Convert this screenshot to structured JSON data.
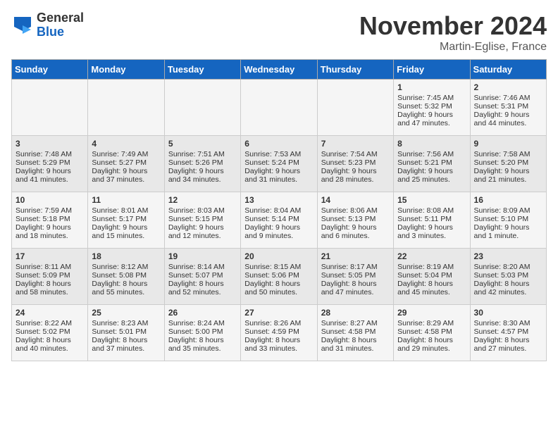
{
  "header": {
    "logo_general": "General",
    "logo_blue": "Blue",
    "month_title": "November 2024",
    "location": "Martin-Eglise, France"
  },
  "days_of_week": [
    "Sunday",
    "Monday",
    "Tuesday",
    "Wednesday",
    "Thursday",
    "Friday",
    "Saturday"
  ],
  "weeks": [
    [
      {
        "day": "",
        "content": ""
      },
      {
        "day": "",
        "content": ""
      },
      {
        "day": "",
        "content": ""
      },
      {
        "day": "",
        "content": ""
      },
      {
        "day": "",
        "content": ""
      },
      {
        "day": "1",
        "content": "Sunrise: 7:45 AM\nSunset: 5:32 PM\nDaylight: 9 hours and 47 minutes."
      },
      {
        "day": "2",
        "content": "Sunrise: 7:46 AM\nSunset: 5:31 PM\nDaylight: 9 hours and 44 minutes."
      }
    ],
    [
      {
        "day": "3",
        "content": "Sunrise: 7:48 AM\nSunset: 5:29 PM\nDaylight: 9 hours and 41 minutes."
      },
      {
        "day": "4",
        "content": "Sunrise: 7:49 AM\nSunset: 5:27 PM\nDaylight: 9 hours and 37 minutes."
      },
      {
        "day": "5",
        "content": "Sunrise: 7:51 AM\nSunset: 5:26 PM\nDaylight: 9 hours and 34 minutes."
      },
      {
        "day": "6",
        "content": "Sunrise: 7:53 AM\nSunset: 5:24 PM\nDaylight: 9 hours and 31 minutes."
      },
      {
        "day": "7",
        "content": "Sunrise: 7:54 AM\nSunset: 5:23 PM\nDaylight: 9 hours and 28 minutes."
      },
      {
        "day": "8",
        "content": "Sunrise: 7:56 AM\nSunset: 5:21 PM\nDaylight: 9 hours and 25 minutes."
      },
      {
        "day": "9",
        "content": "Sunrise: 7:58 AM\nSunset: 5:20 PM\nDaylight: 9 hours and 21 minutes."
      }
    ],
    [
      {
        "day": "10",
        "content": "Sunrise: 7:59 AM\nSunset: 5:18 PM\nDaylight: 9 hours and 18 minutes."
      },
      {
        "day": "11",
        "content": "Sunrise: 8:01 AM\nSunset: 5:17 PM\nDaylight: 9 hours and 15 minutes."
      },
      {
        "day": "12",
        "content": "Sunrise: 8:03 AM\nSunset: 5:15 PM\nDaylight: 9 hours and 12 minutes."
      },
      {
        "day": "13",
        "content": "Sunrise: 8:04 AM\nSunset: 5:14 PM\nDaylight: 9 hours and 9 minutes."
      },
      {
        "day": "14",
        "content": "Sunrise: 8:06 AM\nSunset: 5:13 PM\nDaylight: 9 hours and 6 minutes."
      },
      {
        "day": "15",
        "content": "Sunrise: 8:08 AM\nSunset: 5:11 PM\nDaylight: 9 hours and 3 minutes."
      },
      {
        "day": "16",
        "content": "Sunrise: 8:09 AM\nSunset: 5:10 PM\nDaylight: 9 hours and 1 minute."
      }
    ],
    [
      {
        "day": "17",
        "content": "Sunrise: 8:11 AM\nSunset: 5:09 PM\nDaylight: 8 hours and 58 minutes."
      },
      {
        "day": "18",
        "content": "Sunrise: 8:12 AM\nSunset: 5:08 PM\nDaylight: 8 hours and 55 minutes."
      },
      {
        "day": "19",
        "content": "Sunrise: 8:14 AM\nSunset: 5:07 PM\nDaylight: 8 hours and 52 minutes."
      },
      {
        "day": "20",
        "content": "Sunrise: 8:15 AM\nSunset: 5:06 PM\nDaylight: 8 hours and 50 minutes."
      },
      {
        "day": "21",
        "content": "Sunrise: 8:17 AM\nSunset: 5:05 PM\nDaylight: 8 hours and 47 minutes."
      },
      {
        "day": "22",
        "content": "Sunrise: 8:19 AM\nSunset: 5:04 PM\nDaylight: 8 hours and 45 minutes."
      },
      {
        "day": "23",
        "content": "Sunrise: 8:20 AM\nSunset: 5:03 PM\nDaylight: 8 hours and 42 minutes."
      }
    ],
    [
      {
        "day": "24",
        "content": "Sunrise: 8:22 AM\nSunset: 5:02 PM\nDaylight: 8 hours and 40 minutes."
      },
      {
        "day": "25",
        "content": "Sunrise: 8:23 AM\nSunset: 5:01 PM\nDaylight: 8 hours and 37 minutes."
      },
      {
        "day": "26",
        "content": "Sunrise: 8:24 AM\nSunset: 5:00 PM\nDaylight: 8 hours and 35 minutes."
      },
      {
        "day": "27",
        "content": "Sunrise: 8:26 AM\nSunset: 4:59 PM\nDaylight: 8 hours and 33 minutes."
      },
      {
        "day": "28",
        "content": "Sunrise: 8:27 AM\nSunset: 4:58 PM\nDaylight: 8 hours and 31 minutes."
      },
      {
        "day": "29",
        "content": "Sunrise: 8:29 AM\nSunset: 4:58 PM\nDaylight: 8 hours and 29 minutes."
      },
      {
        "day": "30",
        "content": "Sunrise: 8:30 AM\nSunset: 4:57 PM\nDaylight: 8 hours and 27 minutes."
      }
    ]
  ]
}
